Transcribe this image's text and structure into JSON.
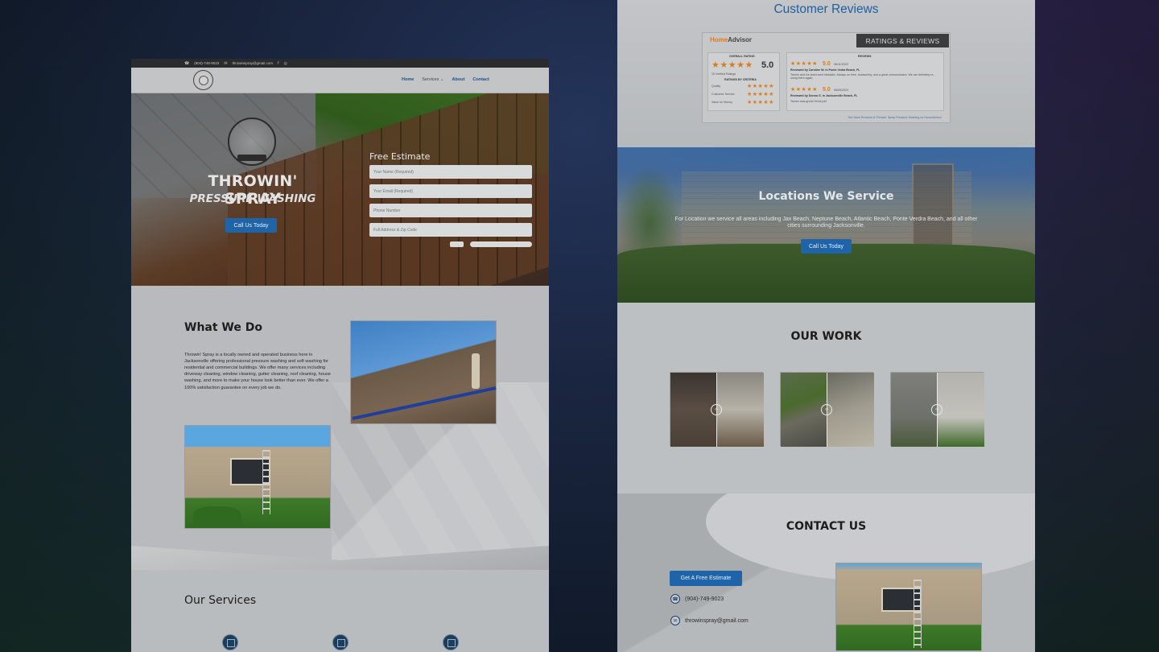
{
  "left": {
    "topbar": {
      "phone": "(904)-749-9023",
      "email": "throwinspray@gmail.com",
      "icons": [
        "facebook-icon",
        "instagram-icon"
      ]
    },
    "nav": {
      "items": [
        "Home",
        "Services",
        "About",
        "Contact"
      ],
      "services_caret": "⌄"
    },
    "hero": {
      "title": "THROWIN' SPRAY",
      "subtitle": "PRESSURE WASHING",
      "cta": "Call Us Today",
      "form": {
        "title": "Free Estimate",
        "name_placeholder": "Your Name (Required)",
        "email_placeholder": "Your Email (Required)",
        "phone_placeholder": "Phone Number",
        "address_placeholder": "Full Address & Zip Code"
      }
    },
    "what": {
      "heading": "What We Do",
      "body": "Throwin' Spray is a locally owned and operated business here in Jacksonville offering professional pressure washing and soft washing for residential and commercial buildings. We offer many services including driveway cleaning, window cleaning, gutter cleaning, roof cleaning, house washing, and more to make your house look better than ever. We offer a 100% satisfaction guarantee on every job we do."
    },
    "services": {
      "heading": "Our Services"
    }
  },
  "right": {
    "reviews": {
      "heading": "Customer Reviews",
      "brand_home": "Home",
      "brand_advisor": "Advisor",
      "tag": "RATINGS & REVIEWS",
      "overall_label": "OVERALL RATING",
      "overall_score": "5.0",
      "overall_stars": "★★★★★",
      "verified": "15 Verified Ratings",
      "criteria_label": "RATINGS BY CRITERIA",
      "criteria": [
        {
          "name": "Quality",
          "stars": "★★★★★"
        },
        {
          "name": "Customer Service",
          "stars": "★★★★★"
        },
        {
          "name": "Value for Money",
          "stars": "★★★★★"
        }
      ],
      "reviews_label": "REVIEWS",
      "entries": [
        {
          "stars": "★★★★★",
          "score": "5.0",
          "date": "06/11/2023",
          "by": "Reviewed by Caroline W. in Ponte Vedra Beach, FL",
          "text": "Tanner and his team were fantastic. Always on time, trustworthy, and a great communicator. We are definitely re-using them again."
        },
        {
          "stars": "★★★★★",
          "score": "5.0",
          "date": "06/05/2023",
          "by": "Reviewed by Donna G. in Jacksonville Beach, FL",
          "text": "Tanner was great! Great job!"
        }
      ],
      "footer": "See More Reviews of Throwin' Spray Pressure Washing on HomeAdvisor"
    },
    "locations": {
      "heading": "Locations We Service",
      "body": "For Location we service all areas including Jax Beach, Neptune Beach, Atlantic Beach, Ponte Verdra Beach, and all other cities surrounding Jacksonville.",
      "cta": "Call Us Today"
    },
    "work": {
      "heading": "OUR WORK",
      "slider_glyph": "‹›"
    },
    "contact": {
      "heading": "CONTACT US",
      "cta": "Get A Free Estimate",
      "phone": "(904)-749-9023",
      "email": "throwinspray@gmail.com"
    }
  }
}
